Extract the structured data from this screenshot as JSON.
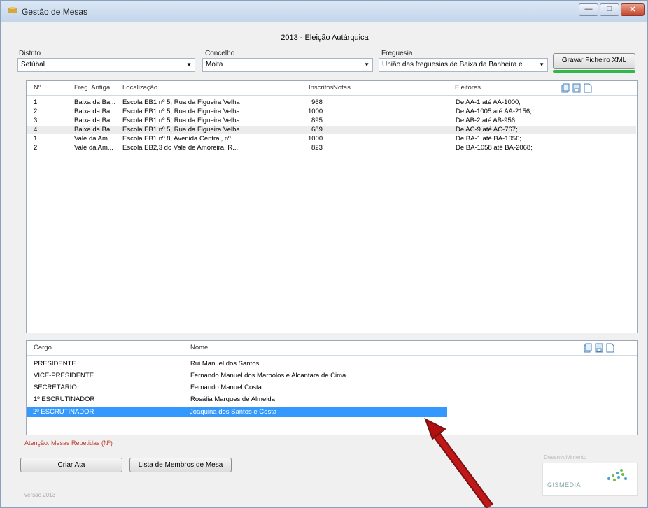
{
  "window": {
    "title": "Gestão de Mesas"
  },
  "section_title": "2013 - Eleição Autárquica",
  "filters": {
    "distrito": {
      "label": "Distrito",
      "value": "Setúbal"
    },
    "concelho": {
      "label": "Concelho",
      "value": "Moita"
    },
    "freguesia": {
      "label": "Freguesia",
      "value": "União das freguesias de Baixa da Banheira e"
    }
  },
  "buttons": {
    "gravar": "Gravar Ficheiro XML",
    "criar_ata": "Criar Ata",
    "lista_membros": "Lista de Membros de Mesa"
  },
  "mesas_table": {
    "columns": [
      "Nº",
      "Freg. Antiga",
      "Localização",
      "Inscritos",
      "Notas",
      "Eleitores"
    ],
    "rows": [
      {
        "n": "1",
        "freg": "Baixa da Ba...",
        "loc": "Escola EB1 nº 5, Rua da Figueira Velha",
        "insc": "968",
        "notas": "",
        "eleit": "De AA-1 até AA-1000;"
      },
      {
        "n": "2",
        "freg": "Baixa da Ba...",
        "loc": "Escola EB1 nº 5, Rua da Figueira Velha",
        "insc": "1000",
        "notas": "",
        "eleit": "De AA-1005 até AA-2156;"
      },
      {
        "n": "3",
        "freg": "Baixa da Ba...",
        "loc": "Escola EB1 nº 5, Rua da Figueira Velha",
        "insc": "895",
        "notas": "",
        "eleit": "De AB-2 até AB-956;"
      },
      {
        "n": "4",
        "freg": "Baixa da Ba...",
        "loc": "Escola EB1 nº 5, Rua da Figueira Velha",
        "insc": "689",
        "notas": "",
        "eleit": "De AC-9 até AC-767;"
      },
      {
        "n": "1",
        "freg": "Vale da Am...",
        "loc": "Escola EB1 nº 8, Avenida Central, nº ...",
        "insc": "1000",
        "notas": "",
        "eleit": "De BA-1 até BA-1056;"
      },
      {
        "n": "2",
        "freg": "Vale da Am...",
        "loc": "Escola EB2,3 do Vale de Amoreira, R...",
        "insc": "823",
        "notas": "",
        "eleit": "De BA-1058 até BA-2068;"
      }
    ]
  },
  "membros_table": {
    "columns": [
      "Cargo",
      "Nome"
    ],
    "rows": [
      {
        "cargo": "PRESIDENTE",
        "nome": "Rui Manuel dos Santos"
      },
      {
        "cargo": "VICE-PRESIDENTE",
        "nome": "Fernando Manuel dos Marbolos e Alcantara de Cima"
      },
      {
        "cargo": "SECRETÁRIO",
        "nome": "Fernando Manuel Costa"
      },
      {
        "cargo": "1º ESCRUTINADOR",
        "nome": "Rosália Marques de Almeida"
      },
      {
        "cargo": "2º ESCRUTINADOR",
        "nome": "Joaquina dos Santos e Costa"
      }
    ]
  },
  "warning": "Atenção: Mesas Repetidas (Nº)",
  "footer": {
    "version": "versão 2013",
    "developer_label": "Desenvolvimento",
    "logo_text": "GISMEDIA"
  },
  "colors": {
    "selection": "#3399ff",
    "warning": "#c0392b",
    "green_bar": "#31b84a",
    "arrow": "#b01010"
  }
}
